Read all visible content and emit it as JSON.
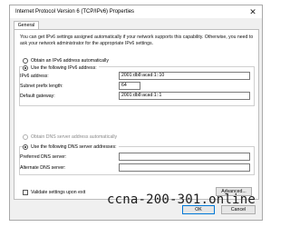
{
  "window": {
    "title": "Internet Protocol Version 6 (TCP/IPv6) Properties",
    "close": "✕"
  },
  "tabs": [
    {
      "label": "General"
    }
  ],
  "description": "You can get IPv6 settings assigned automatically if your network supports this capability. Otherwise, you need to ask your network administrator for the appropriate IPv6 settings.",
  "ip": {
    "auto_label": "Obtain an IPv6 address automatically",
    "manual_label": "Use the following IPv6 address:",
    "selected": "manual",
    "fields": [
      {
        "label": "IPv6 address:",
        "value": "2001:db8:acad:1::10"
      },
      {
        "label": "Subnet prefix length:",
        "value": "64"
      },
      {
        "label": "Default gateway:",
        "value": "2001:db8:acad:1::1"
      }
    ]
  },
  "dns": {
    "auto_label": "Obtain DNS server address automatically",
    "manual_label": "Use the following DNS server addresses:",
    "selected": "manual",
    "fields": [
      {
        "label": "Preferred DNS server:",
        "value": ""
      },
      {
        "label": "Alternate DNS server:",
        "value": ""
      }
    ]
  },
  "validate_label": "Validate settings upon exit",
  "validate_checked": false,
  "buttons": {
    "advanced": "Advanced...",
    "ok": "OK",
    "cancel": "Cancel"
  },
  "watermark": "ccna-200-301.online"
}
